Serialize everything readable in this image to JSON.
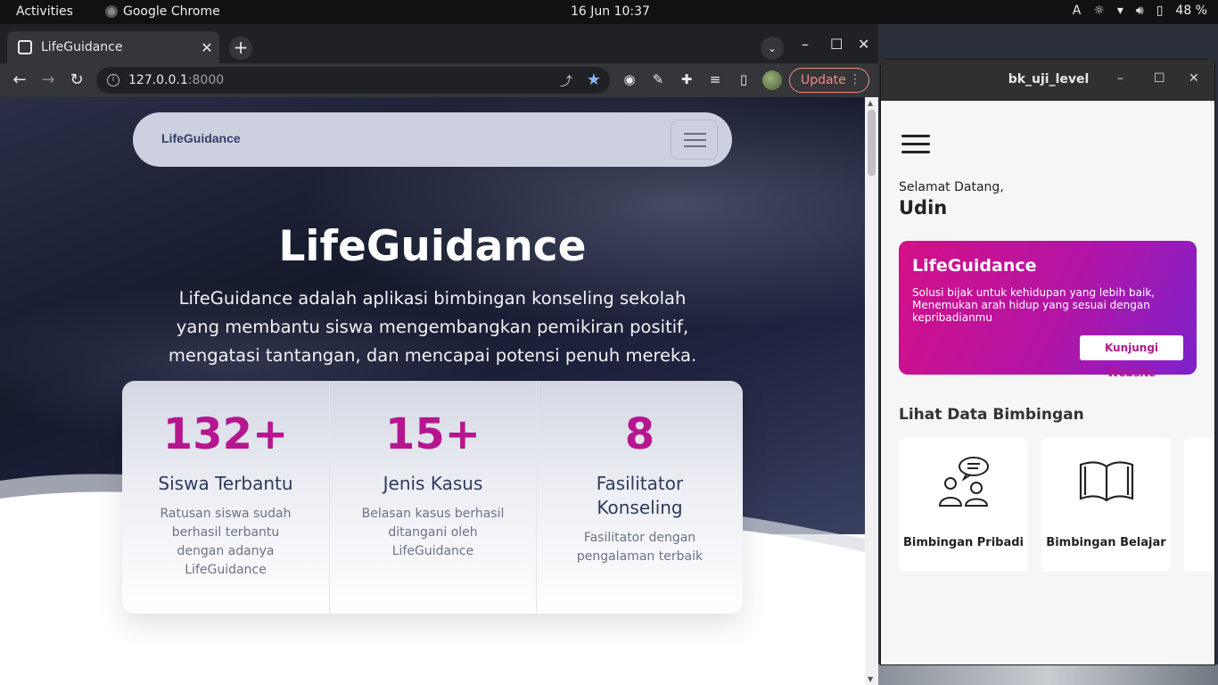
{
  "topbar": {
    "activities": "Activities",
    "app_name": "Google Chrome",
    "clock": "16 Jun  10:37",
    "keyboard": "A",
    "battery": "48 %"
  },
  "chrome": {
    "tab_title": "LifeGuidance",
    "url_host": "127.0.0.1",
    "url_port": ":8000",
    "update_label": "Update"
  },
  "site": {
    "brand": "LifeGuidance",
    "hero_title": "LifeGuidance",
    "hero_desc": "LifeGuidance adalah aplikasi bimbingan konseling sekolah yang membantu siswa mengembangkan pemikiran positif, mengatasi tantangan, dan mencapai potensi penuh mereka.",
    "stats": [
      {
        "num": "132+",
        "label": "Siswa Terbantu",
        "sub": "Ratusan siswa sudah berhasil terbantu dengan adanya LifeGuidance"
      },
      {
        "num": "15+",
        "label": "Jenis Kasus",
        "sub": "Belasan kasus berhasil ditangani oleh LifeGuidance"
      },
      {
        "num": "8",
        "label": "Fasilitator Konseling",
        "sub": "Fasilitator dengan pengalaman terbaik"
      }
    ]
  },
  "app": {
    "window_title": "bk_uji_level",
    "greeting": "Selamat Datang,",
    "user": "Udin",
    "banner_title": "LifeGuidance",
    "banner_desc": "Solusi bijak untuk kehidupan yang lebih baik, Menemukan arah hidup yang sesuai dengan kepribadianmu",
    "banner_button": "Kunjungi Website",
    "section_title": "Lihat Data Bimbingan",
    "cards": [
      {
        "label": "Bimbingan Pribadi",
        "icon": "people-chat-icon"
      },
      {
        "label": "Bimbingan Belajar",
        "icon": "book-icon"
      }
    ]
  }
}
